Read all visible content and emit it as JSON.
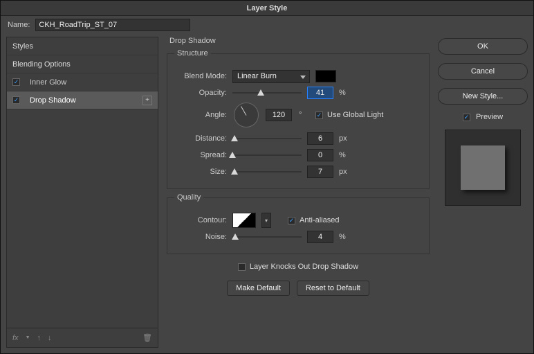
{
  "title": "Layer Style",
  "name": {
    "label": "Name:",
    "value": "CKH_RoadTrip_ST_07"
  },
  "left_panel": {
    "styles_header": "Styles",
    "blending_header": "Blending Options",
    "effects": [
      {
        "label": "Inner Glow",
        "checked": true,
        "selected": false,
        "has_add": false
      },
      {
        "label": "Drop Shadow",
        "checked": true,
        "selected": true,
        "has_add": true
      }
    ],
    "footer": {
      "fx": "fx",
      "up": "↑",
      "down": "↓",
      "trash": "🗑"
    }
  },
  "effect": {
    "title": "Drop Shadow",
    "structure_legend": "Structure",
    "blend_mode": {
      "label": "Blend Mode:",
      "value": "Linear Burn",
      "color": "#000000"
    },
    "opacity": {
      "label": "Opacity:",
      "value": "41",
      "unit": "%",
      "pct": 41
    },
    "angle": {
      "label": "Angle:",
      "value": "120",
      "unit": "°",
      "global_label": "Use Global Light",
      "global_checked": true
    },
    "distance": {
      "label": "Distance:",
      "value": "6",
      "unit": "px",
      "pct": 3
    },
    "spread": {
      "label": "Spread:",
      "value": "0",
      "unit": "%",
      "pct": 0
    },
    "size": {
      "label": "Size:",
      "value": "7",
      "unit": "px",
      "pct": 3
    },
    "quality_legend": "Quality",
    "contour": {
      "label": "Contour:",
      "aa_label": "Anti-aliased",
      "aa_checked": true
    },
    "noise": {
      "label": "Noise:",
      "value": "4",
      "unit": "%",
      "pct": 4
    },
    "knockout": {
      "label": "Layer Knocks Out Drop Shadow",
      "checked": false
    },
    "make_default": "Make Default",
    "reset_default": "Reset to Default"
  },
  "right": {
    "ok": "OK",
    "cancel": "Cancel",
    "new_style": "New Style...",
    "preview_label": "Preview",
    "preview_checked": true
  }
}
